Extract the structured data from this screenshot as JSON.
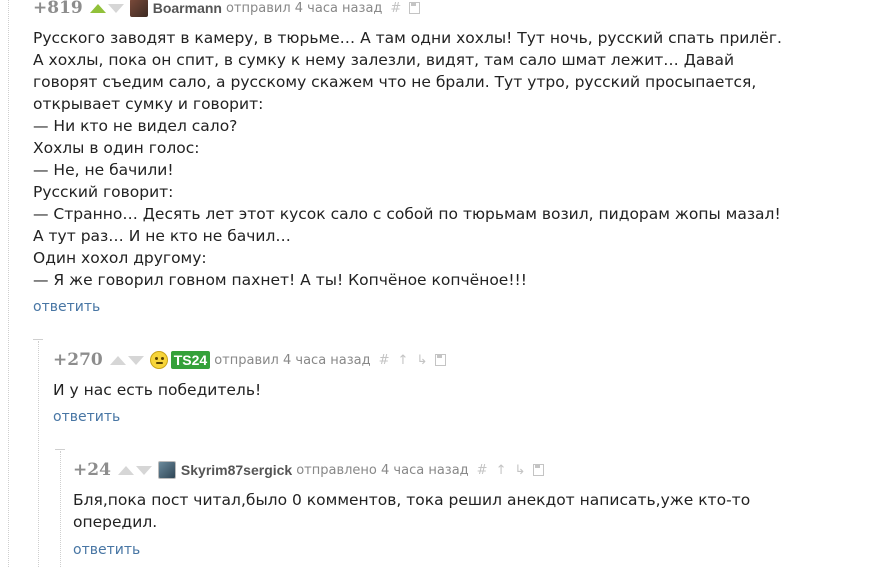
{
  "comments": [
    {
      "rating": "+819",
      "user": "Boarmann",
      "action": "отправил 4 часа назад",
      "text": "Русского заводят в камеру, в тюрьме… А там одни хохлы! Тут ночь, русский спать прилёг.\nА хохлы, пока он спит, в сумку к нему залезли, видят, там сало шмат лежит… Давай\nговорят съедим сало, а русскому скажем что не брали. Тут утро, русский просыпается,\nоткрывает сумку и говорит:\n— Ни кто не видел сало?\nХохлы в один голос:\n— Не, не бачили!\nРусский говорит:\n— Странно… Десять лет этот кусок сало с собой по тюрьмам возил, пидорам жопы мазал!\nА тут раз… И не кто не бачил…\nОдин хохол другому:\n— Я же говорил говном пахнет! А ты! Копчёное копчёное!!!",
      "reply": "ответить"
    },
    {
      "rating": "+270",
      "user": "TS24",
      "action": "отправил 4 часа назад",
      "text": "И у нас есть победитель!",
      "reply": "ответить"
    },
    {
      "rating": "+24",
      "user": "Skyrim87sergick",
      "action": "отправлено 4 часа назад",
      "text": "Бля,пока пост читал,было 0 комментов, тока решил анекдот написать,уже кто-то\nопередил.",
      "reply": "ответить"
    }
  ],
  "icons": {
    "hash": "#",
    "up": "↑",
    "branch": "↳"
  },
  "colors": {
    "upvote_active": "#91c13a",
    "link": "#4876a4",
    "badge": "#34a13a"
  }
}
